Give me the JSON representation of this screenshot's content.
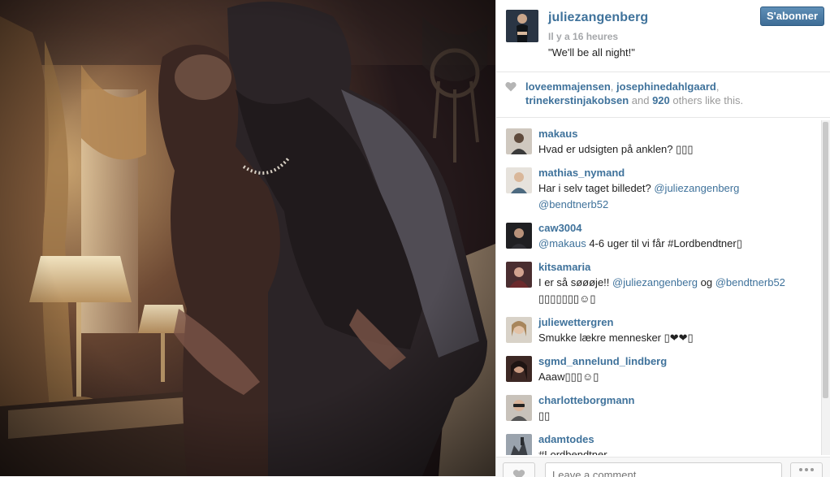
{
  "post": {
    "owner": "juliezangenberg",
    "timestamp": "Il y a 16 heures",
    "caption": "\"We'll be all night!\"",
    "follow_label": "S'abonner"
  },
  "likes": {
    "user1": "loveemmajensen",
    "sep1": ", ",
    "user2": "josephinedahlgaard",
    "sep2": ",",
    "user3": "trinekerstinjakobsen",
    "and_text": " and ",
    "count": "920",
    "suffix": " others like this."
  },
  "comments": [
    {
      "user": "makaus",
      "parts": [
        "Hvad er udsigten på anklen? ▯▯▯"
      ]
    },
    {
      "user": "mathias_nymand",
      "parts": [
        "Har i selv taget billedet? ",
        "@juliezangenberg",
        " ",
        "@bendtnerb52"
      ]
    },
    {
      "user": "caw3004",
      "parts": [
        "@makaus",
        " 4-6 uger til vi får #Lordbendtner▯"
      ]
    },
    {
      "user": "kitsamaria",
      "parts": [
        "I er så søøøje!! ",
        "@juliezangenberg",
        " og ",
        "@bendtnerb52",
        " ▯▯▯▯▯▯▯☺▯"
      ]
    },
    {
      "user": "juliewettergren",
      "parts": [
        "Smukke lækre mennesker ▯❤❤▯"
      ]
    },
    {
      "user": "sgmd_annelund_lindberg",
      "parts": [
        "Aaaw▯▯▯☺▯"
      ]
    },
    {
      "user": "charlotteborgmann",
      "parts": [
        "▯▯"
      ]
    },
    {
      "user": "adamtodes",
      "parts": [
        "#Lordbendtner"
      ]
    }
  ],
  "footer": {
    "comment_placeholder": "Leave a comment..."
  },
  "icons": {
    "like": "heart-icon",
    "more": "ellipsis-icon"
  },
  "colors": {
    "username": "#3f729b",
    "follow_button": "#4a7aa5",
    "meta_text": "#a5a7aa"
  }
}
